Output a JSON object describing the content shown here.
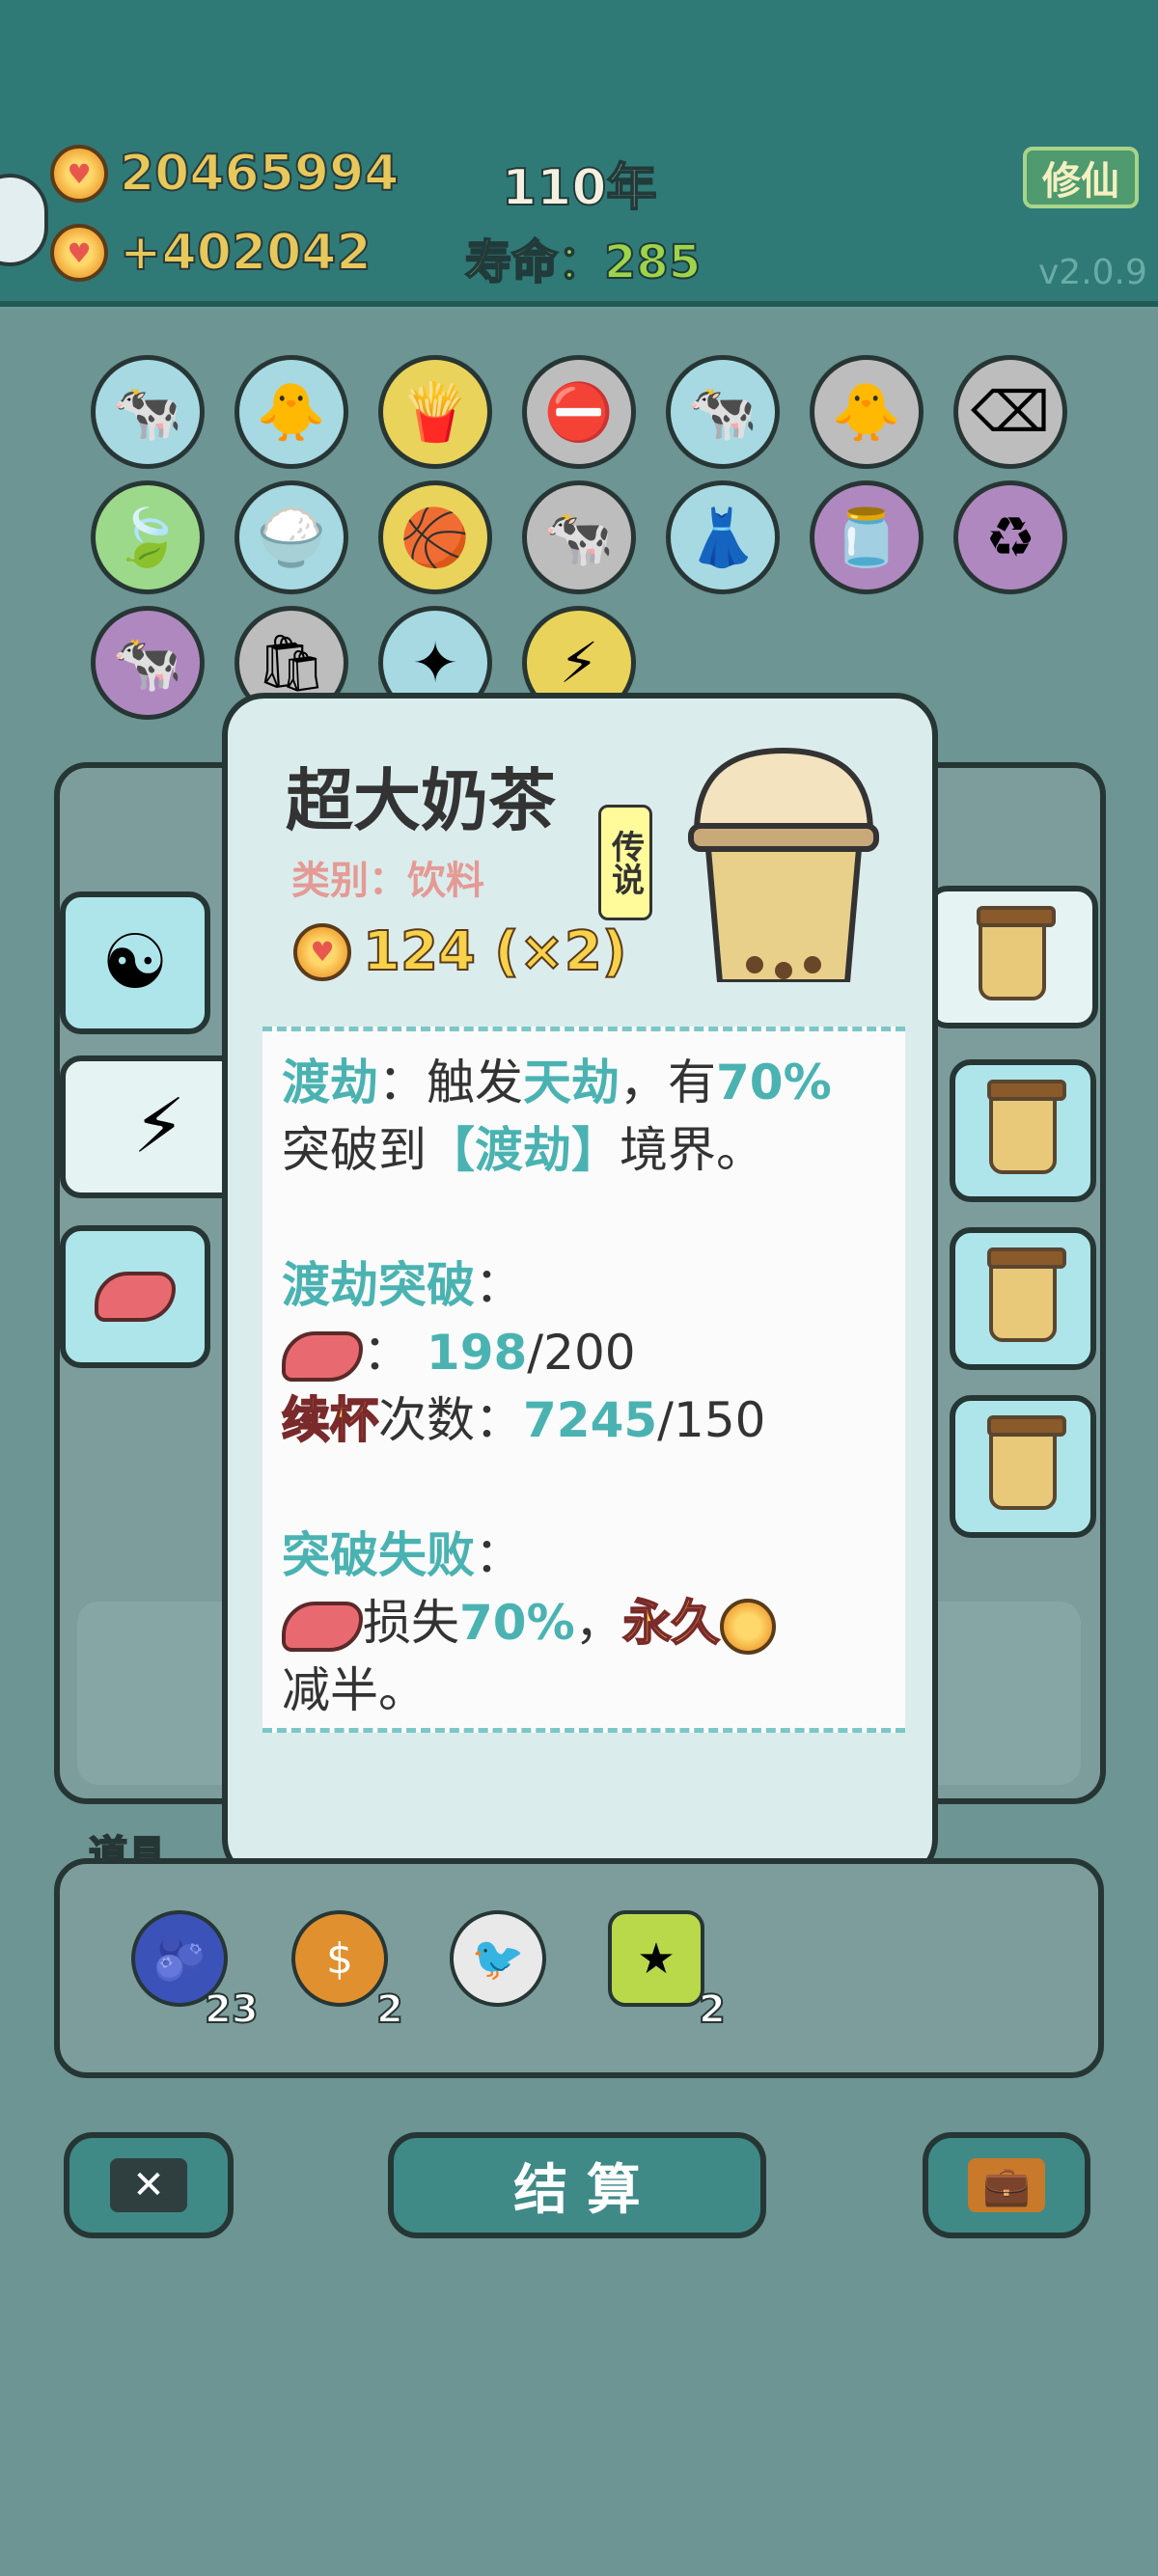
{
  "header": {
    "coins": "20465994",
    "income": "+402042",
    "year": "110年",
    "lifespan_label": "寿命：",
    "lifespan_value": "285",
    "mode_button": "修仙",
    "version": "v2.0.9"
  },
  "tooltip": {
    "title": "超大奶茶",
    "category": "类别：饮料",
    "rarity": "传说",
    "price": "124 (×2)",
    "desc": {
      "w1": "渡劫",
      "t1": "：触发",
      "w2": "天劫",
      "t2": "，有",
      "w3": "70%",
      "t3": "突破到",
      "w4": "【渡劫】",
      "t4": "境界。",
      "h2": "渡劫突破",
      "colon": "：",
      "liver_cur": "198",
      "liver_max": "/200",
      "refill": "续杯",
      "refill_label": "次数：",
      "refill_cur": "7245",
      "refill_max": "/150",
      "h3": "突破失败",
      "t5": "损失",
      "w5": "70%",
      "comma": "，",
      "w6": "永久",
      "t6": "减半。"
    }
  },
  "items_section": {
    "label": "道具",
    "items": [
      {
        "name": "blueberry",
        "count": "23"
      },
      {
        "name": "dollar-coin",
        "count": "2"
      },
      {
        "name": "pigeon",
        "count": ""
      },
      {
        "name": "star",
        "count": "2"
      }
    ]
  },
  "buttons": {
    "settle": "结 算"
  },
  "colors": {
    "header_bg": "#2f7a77",
    "accent_teal": "#4ab3b2",
    "gold": "#f4d44a"
  }
}
